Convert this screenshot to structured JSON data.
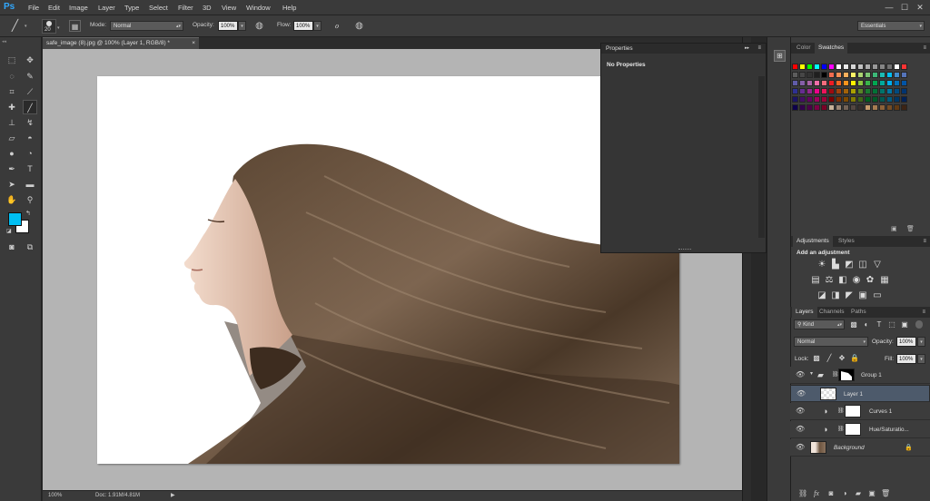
{
  "app": {
    "logo": "Ps"
  },
  "menu": [
    "File",
    "Edit",
    "Image",
    "Layer",
    "Type",
    "Select",
    "Filter",
    "3D",
    "View",
    "Window",
    "Help"
  ],
  "window_controls": {
    "minimize": "—",
    "maximize": "☐",
    "close": "✕"
  },
  "options": {
    "brush_size": "20",
    "mode_label": "Mode:",
    "mode_value": "Normal",
    "opacity_label": "Opacity:",
    "opacity_value": "100%",
    "flow_label": "Flow:",
    "flow_value": "100%",
    "workspace": "Essentials"
  },
  "document": {
    "tab_title": "safe_image (8).jpg @ 100% (Layer 1, RGB/8) *",
    "tab_close": "×",
    "zoom": "100%",
    "doc_info": "Doc: 1.91M/4.81M"
  },
  "properties": {
    "title": "Properties",
    "content": "No Properties",
    "collapse": "▸▸"
  },
  "color_panel": {
    "tabs": [
      "Color",
      "Swatches"
    ],
    "active_tab": "Swatches",
    "swatches": [
      "#ff0000",
      "#ffff00",
      "#00ff00",
      "#00ffff",
      "#0000ff",
      "#ff00ff",
      "#ffffff",
      "#ebebeb",
      "#d6d6d6",
      "#c2c2c2",
      "#adadad",
      "#999999",
      "#858585",
      "#707070",
      "#ffffff",
      "#ff3333",
      "#5c5c5c",
      "#474747",
      "#333333",
      "#1f1f1f",
      "#000000",
      "#f26c4f",
      "#f68e55",
      "#fbaf5c",
      "#fff467",
      "#acd372",
      "#7dc473",
      "#3cb878",
      "#1cbbb4",
      "#00bff3",
      "#438ccb",
      "#5574b9",
      "#605ca8",
      "#855fa8",
      "#a864a8",
      "#f06ea9",
      "#f26d7d",
      "#ed1c24",
      "#f26522",
      "#f7941d",
      "#fff200",
      "#8dc63f",
      "#39b54a",
      "#00a651",
      "#00a99d",
      "#00aeef",
      "#0072bc",
      "#0054a6",
      "#2e3192",
      "#662d91",
      "#92278f",
      "#ec008c",
      "#ed145b",
      "#9e0b0f",
      "#a0410d",
      "#a36209",
      "#aba000",
      "#598527",
      "#1a7b30",
      "#007236",
      "#00746b",
      "#0076a3",
      "#004b80",
      "#003471",
      "#1b1464",
      "#440e62",
      "#630460",
      "#9e005d",
      "#9e0039",
      "#790000",
      "#7b2e00",
      "#7d4900",
      "#827b00",
      "#406618",
      "#005e20",
      "#005826",
      "#005952",
      "#005b7f",
      "#003663",
      "#002157",
      "#0d004c",
      "#32004b",
      "#4b0049",
      "#7b0046",
      "#7a0026",
      "#c7b299",
      "#998675",
      "#736357",
      "#534741",
      "#37302d",
      "#c69c6d",
      "#a67c52",
      "#8c6239",
      "#754c24",
      "#603913",
      "#3c2415"
    ]
  },
  "adjustments": {
    "tabs": [
      "Adjustments",
      "Styles"
    ],
    "active_tab": "Adjustments",
    "heading": "Add an adjustment"
  },
  "layers_panel": {
    "tabs": [
      "Layers",
      "Channels",
      "Paths"
    ],
    "active_tab": "Layers",
    "filter_kind": "Kind",
    "blend_mode": "Normal",
    "opacity_label": "Opacity:",
    "opacity_value": "100%",
    "lock_label": "Lock:",
    "fill_label": "Fill:",
    "fill_value": "100%",
    "layers": [
      {
        "name": "Group 1",
        "type": "group",
        "selected": false
      },
      {
        "name": "Layer 1",
        "type": "pixel",
        "selected": true
      },
      {
        "name": "Curves 1",
        "type": "adjustment",
        "selected": false
      },
      {
        "name": "Hue/Saturatio...",
        "type": "adjustment",
        "selected": false
      },
      {
        "name": "Background",
        "type": "background",
        "selected": false
      }
    ]
  },
  "colors": {
    "foreground": "#00bff3",
    "background": "#ffffff",
    "accent": "#31a8ff"
  }
}
